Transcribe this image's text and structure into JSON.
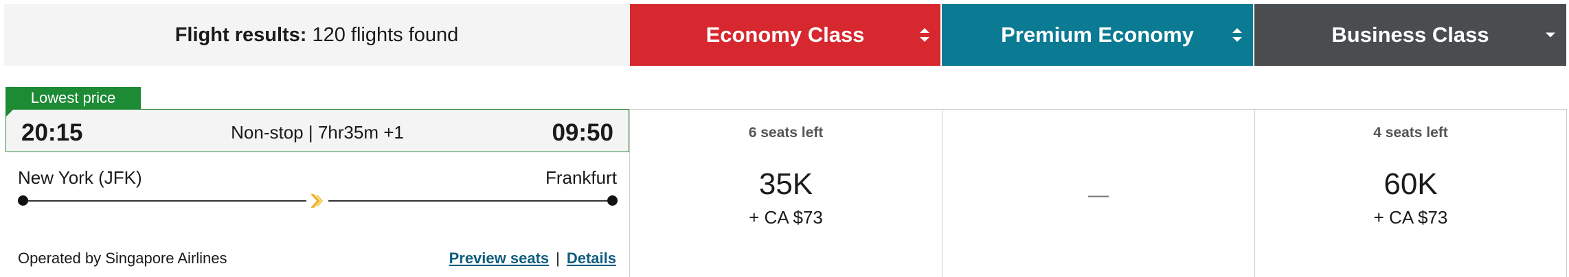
{
  "header": {
    "results_label": "Flight results:",
    "results_count": "120 flights found"
  },
  "cabins": {
    "economy": {
      "label": "Economy Class",
      "color": "#d7282f"
    },
    "premium": {
      "label": "Premium Economy",
      "color": "#0b7a93"
    },
    "business": {
      "label": "Business Class",
      "color": "#4a4d50"
    }
  },
  "flight": {
    "badge": "Lowest price",
    "badge_color": "#1d8a34",
    "departure_time": "20:15",
    "arrival_time": "09:50",
    "route_info": "Non-stop | 7hr35m +1",
    "origin": "New York (JFK)",
    "destination": "Frankfurt",
    "airline_logo": "singapore-airlines-logo",
    "operated_by": "Operated by Singapore Airlines",
    "preview_seats": "Preview seats",
    "link_separator": "|",
    "details": "Details"
  },
  "fares": {
    "economy": {
      "seats": "6 seats left",
      "price": "35K",
      "tax": "+ CA $73"
    },
    "premium": {
      "na": "—"
    },
    "business": {
      "seats": "4 seats left",
      "price": "60K",
      "tax": "+ CA $73"
    }
  }
}
